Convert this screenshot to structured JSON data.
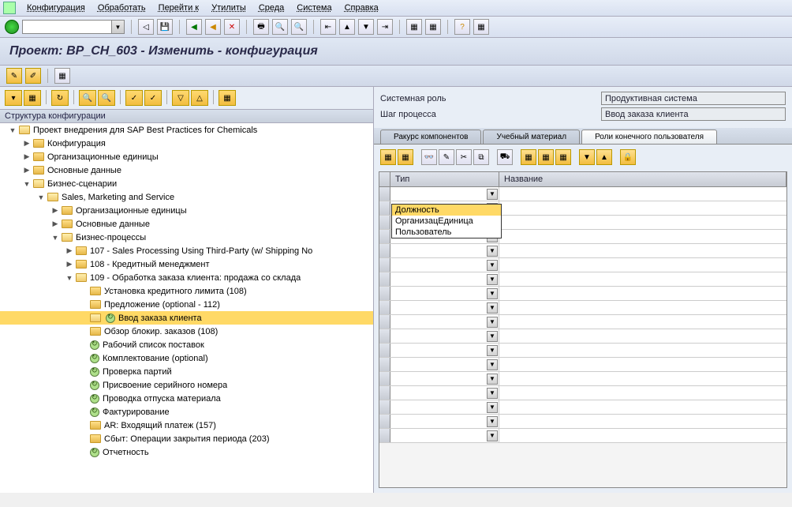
{
  "menu": [
    "Конфигурация",
    "Обработать",
    "Перейти к",
    "Утилиты",
    "Среда",
    "Система",
    "Справка"
  ],
  "title": "Проект: BP_CH_603 - Изменить - конфигурация",
  "tree_header": "Структура конфигурации",
  "info": {
    "role_label": "Системная роль",
    "role_value": "Продуктивная  система",
    "step_label": "Шаг процесса",
    "step_value": "Ввод заказа клиента"
  },
  "tabs": [
    "Ракурс компонентов",
    "Учебный материал",
    "Роли конечного пользователя"
  ],
  "active_tab": 2,
  "grid": {
    "col_type": "Тип",
    "col_name": "Название"
  },
  "dropdown": [
    "Должность",
    "ОрганизацЕдиница",
    "Пользователь"
  ],
  "tree": [
    {
      "d": 0,
      "t": "▼",
      "i": "fo",
      "l": "Проект внедрения для SAP Best Practices for Chemicals"
    },
    {
      "d": 1,
      "t": "▶",
      "i": "f",
      "l": "Конфигурация"
    },
    {
      "d": 1,
      "t": "▶",
      "i": "f",
      "l": "Организационные единицы"
    },
    {
      "d": 1,
      "t": "▶",
      "i": "f",
      "l": "Основные данные"
    },
    {
      "d": 1,
      "t": "▼",
      "i": "fo",
      "l": "Бизнес-сценарии"
    },
    {
      "d": 2,
      "t": "▼",
      "i": "fo",
      "l": "Sales, Marketing and Service"
    },
    {
      "d": 3,
      "t": "▶",
      "i": "f",
      "l": "Организационные единицы"
    },
    {
      "d": 3,
      "t": "▶",
      "i": "f",
      "l": "Основные данные"
    },
    {
      "d": 3,
      "t": "▼",
      "i": "fo",
      "l": "Бизнес-процессы"
    },
    {
      "d": 4,
      "t": "▶",
      "i": "f",
      "l": "107 - Sales Processing Using Third-Party (w/ Shipping No"
    },
    {
      "d": 4,
      "t": "▶",
      "i": "f",
      "l": "108 - Кредитный менеджмент"
    },
    {
      "d": 4,
      "t": "▼",
      "i": "fo",
      "l": "109 - Обработка заказа клиента: продажа со склада"
    },
    {
      "d": 5,
      "t": " ",
      "i": "f",
      "l": "Установка кредитного лимита (108)"
    },
    {
      "d": 5,
      "t": " ",
      "i": "f",
      "l": "Предложение (optional - 112)"
    },
    {
      "d": 5,
      "t": " ",
      "i": "fo",
      "l": "Ввод заказа клиента",
      "sel": true,
      "clk": true
    },
    {
      "d": 5,
      "t": " ",
      "i": "f",
      "l": "Обзор блокир. заказов (108)"
    },
    {
      "d": 5,
      "t": " ",
      "i": "c",
      "l": "Рабочий список поставок"
    },
    {
      "d": 5,
      "t": " ",
      "i": "c",
      "l": "Комплектование (optional)"
    },
    {
      "d": 5,
      "t": " ",
      "i": "c",
      "l": "Проверка партий"
    },
    {
      "d": 5,
      "t": " ",
      "i": "c",
      "l": "Присвоение серийного номера"
    },
    {
      "d": 5,
      "t": " ",
      "i": "c",
      "l": "Проводка отпуска материала"
    },
    {
      "d": 5,
      "t": " ",
      "i": "c",
      "l": "Фактурирование"
    },
    {
      "d": 5,
      "t": " ",
      "i": "f",
      "l": "AR: Входящий платеж (157)"
    },
    {
      "d": 5,
      "t": " ",
      "i": "f",
      "l": "Сбыт: Операции закрытия периода (203)"
    },
    {
      "d": 5,
      "t": " ",
      "i": "c",
      "l": "Отчетность"
    }
  ]
}
